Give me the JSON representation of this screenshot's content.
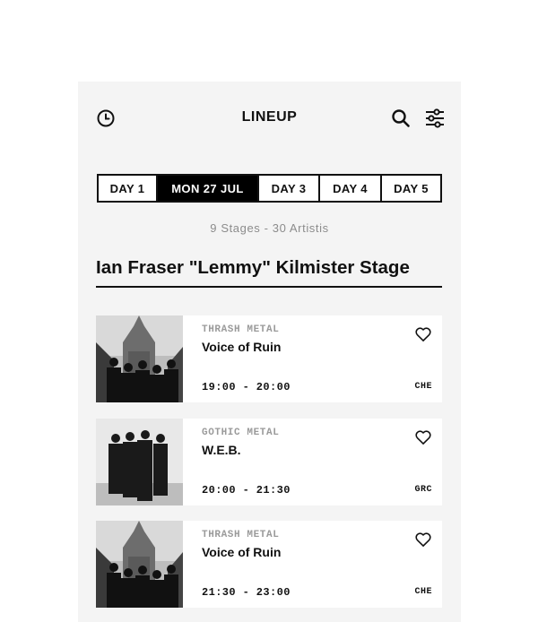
{
  "header": {
    "title": "LINEUP"
  },
  "icons": {
    "history": "clock-icon",
    "search": "search-icon",
    "filter": "sliders-icon",
    "favorite": "heart-outline-icon"
  },
  "tabs": [
    {
      "label": "DAY 1",
      "active": false
    },
    {
      "label": "MON 27 JUL",
      "active": true
    },
    {
      "label": "DAY 3",
      "active": false
    },
    {
      "label": "DAY 4",
      "active": false
    },
    {
      "label": "DAY 5",
      "active": false
    }
  ],
  "stats": "9 Stages - 30 Artistis",
  "stage": {
    "name": "Ian Fraser \"Lemmy\" Kilmister Stage"
  },
  "performances": [
    {
      "genre": "THRASH METAL",
      "artist": "Voice of Ruin",
      "time": "19:00 - 20:00",
      "country": "CHE"
    },
    {
      "genre": "GOTHIC METAL",
      "artist": "W.E.B.",
      "time": "20:00 - 21:30",
      "country": "GRC"
    },
    {
      "genre": "THRASH METAL",
      "artist": "Voice of Ruin",
      "time": "21:30 - 23:00",
      "country": "CHE"
    }
  ],
  "colors": {
    "accent": "#000000",
    "background": "#f4f4f4",
    "muted": "#9a9a9a"
  }
}
